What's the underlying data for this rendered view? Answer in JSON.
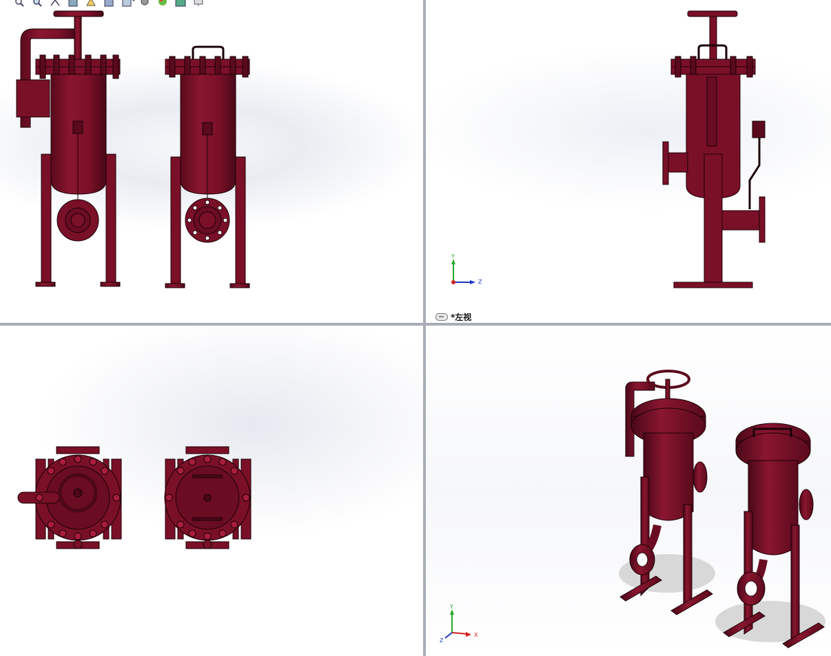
{
  "toolbar": {
    "items": [
      {
        "name": "zoom-to-fit-icon"
      },
      {
        "name": "zoom-to-area-icon"
      },
      {
        "name": "previous-view-icon"
      },
      {
        "name": "section-view-icon"
      },
      {
        "name": "dynamic-annotation-icon"
      },
      {
        "name": "view-orientation-icon"
      },
      {
        "name": "display-style-icon"
      },
      {
        "name": "hide-show-items-icon"
      },
      {
        "name": "edit-appearance-icon"
      },
      {
        "name": "apply-scene-icon"
      },
      {
        "name": "view-settings-icon"
      }
    ]
  },
  "viewports": {
    "left_view_label": "*左视"
  },
  "triads": {
    "left": {
      "y": "Y",
      "z": "Z"
    },
    "iso": {
      "y": "Y",
      "x": "X",
      "z": "Z"
    }
  },
  "colors": {
    "model_fill": "#7a1028",
    "model_dark": "#4a0818",
    "model_edge": "#1a0006",
    "hole": "#ffffff",
    "axis_x": "#d0201c",
    "axis_y": "#2aa82a",
    "axis_z": "#1c36c8"
  }
}
